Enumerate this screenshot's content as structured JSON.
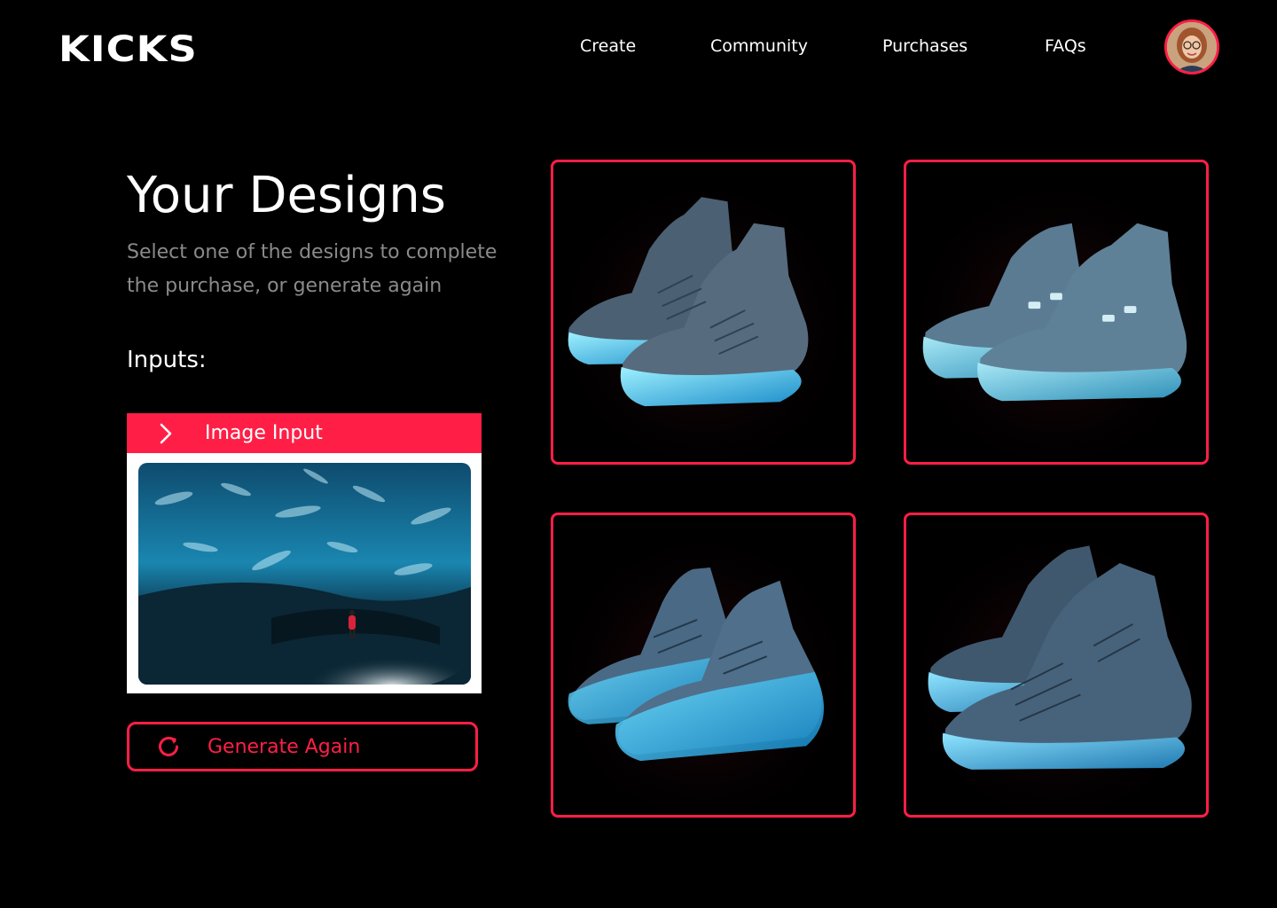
{
  "header": {
    "logo": "KICKS",
    "nav": [
      {
        "label": "Create"
      },
      {
        "label": "Community"
      },
      {
        "label": "Purchases"
      },
      {
        "label": "FAQs"
      }
    ],
    "avatar_icon": "user-avatar"
  },
  "main": {
    "title": "Your Designs",
    "subtitle": "Select one of the designs to complete the purchase, or generate again",
    "inputs_label": "Inputs:",
    "image_input": {
      "label": "Image Input",
      "icon": "chevron-right-icon"
    },
    "generate_button": {
      "label": "Generate Again",
      "icon": "refresh-icon"
    },
    "designs": [
      {
        "name": "design-1"
      },
      {
        "name": "design-2"
      },
      {
        "name": "design-3"
      },
      {
        "name": "design-4"
      }
    ]
  },
  "colors": {
    "accent": "#ff1f46",
    "background": "#000000",
    "muted_text": "#8a8a8a",
    "ice": "#5fd0f0"
  }
}
